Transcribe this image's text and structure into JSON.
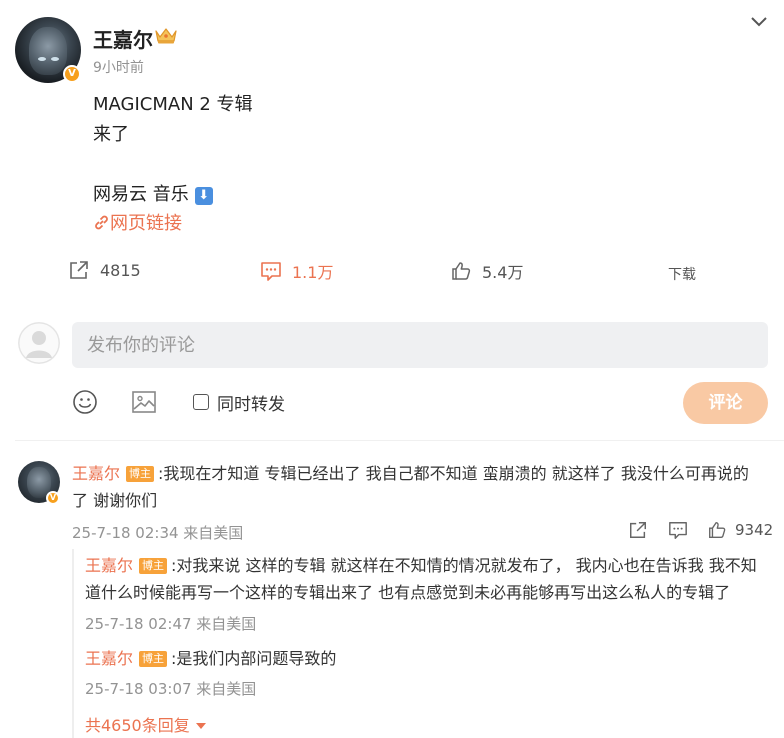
{
  "post": {
    "author": "王嘉尔",
    "verified_badge": "V",
    "time": "9小时前",
    "lines": [
      "MAGICMAN 2 专辑",
      "来了",
      "网易云 音乐"
    ],
    "download_arrow": "⬇",
    "link_text": "网页链接",
    "actions": {
      "share_count": "4815",
      "comment_count": "1.1万",
      "like_count": "5.4万",
      "download_label": "下载"
    },
    "accent_color": "#eb7350"
  },
  "composer": {
    "placeholder": "发布你的评论",
    "forward_label": "同时转发",
    "submit_label": "评论"
  },
  "comment": {
    "author": "王嘉尔",
    "tag": "博主",
    "text_line1": ":我现在才知道 专辑已经出了 我自己都不知道 蛮崩溃的  就这样了 我没什么可再说的",
    "text_line2": "了  谢谢你们",
    "meta": "25-7-18 02:34 来自美国",
    "like_count": "9342",
    "replies": [
      {
        "author": "王嘉尔",
        "tag": "博主",
        "text_line1": ":对我来说 这样的专辑 就这样在不知情的情况就发布了，  我内心也在告诉我 我不知",
        "text_line2": "道什么时候能再写一个这样的专辑出来了 也有点感觉到未必再能够再写出这么私人的专辑了",
        "meta": "25-7-18 02:47 来自美国"
      },
      {
        "author": "王嘉尔",
        "tag": "博主",
        "text_line1": ":是我们内部问题导致的",
        "meta": "25-7-18 03:07 来自美国"
      }
    ],
    "more_replies": "共4650条回复"
  }
}
